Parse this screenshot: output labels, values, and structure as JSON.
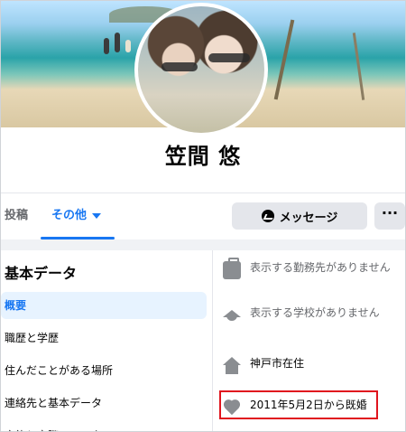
{
  "profile": {
    "name": "笠間 悠"
  },
  "tabs": {
    "posts": "投稿",
    "more": "その他"
  },
  "actions": {
    "message": "メッセージ",
    "more": "···"
  },
  "about": {
    "title": "基本データ",
    "nav": [
      {
        "label": "概要",
        "active": true
      },
      {
        "label": "職歴と学歴",
        "active": false
      },
      {
        "label": "住んだことがある場所",
        "active": false
      },
      {
        "label": "連絡先と基本データ",
        "active": false
      },
      {
        "label": "家族と交際ステータス",
        "active": false
      }
    ],
    "details": [
      {
        "icon": "briefcase-icon",
        "text": "表示する勤務先がありません"
      },
      {
        "icon": "graduation-cap-icon",
        "text": "表示する学校がありません"
      },
      {
        "icon": "home-icon",
        "text": "神戸市在住"
      },
      {
        "icon": "heart-icon",
        "text": "2011年5月2日から既婚"
      }
    ]
  },
  "colors": {
    "accent": "#1877f2",
    "highlight": "#e0141e"
  }
}
